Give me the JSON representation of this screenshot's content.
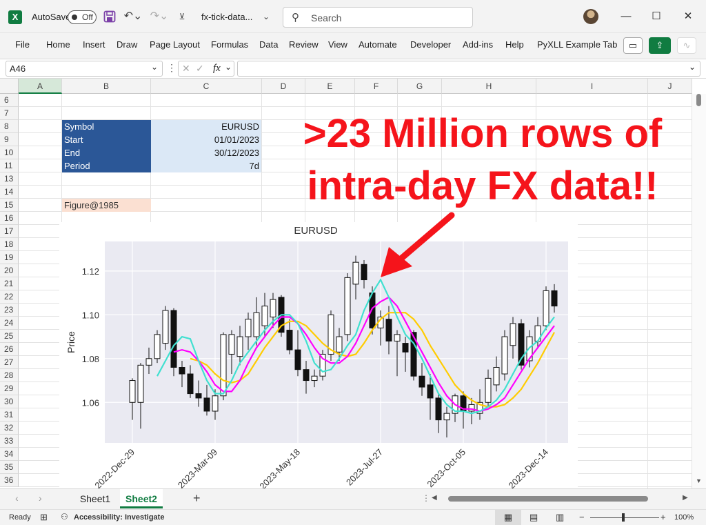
{
  "titlebar": {
    "autosave_label": "AutoSave",
    "autosave_state": "Off",
    "filename": "fx-tick-data...",
    "search_placeholder": "Search"
  },
  "ribbon": {
    "tabs": [
      "File",
      "Home",
      "Insert",
      "Draw",
      "Page Layout",
      "Formulas",
      "Data",
      "Review",
      "View",
      "Automate",
      "Developer",
      "Add-ins",
      "Help",
      "PyXLL Example Tab"
    ]
  },
  "formula_bar": {
    "name_box": "A46",
    "fx_label": "fx",
    "formula": ""
  },
  "grid": {
    "columns": [
      "A",
      "B",
      "C",
      "D",
      "E",
      "F",
      "G",
      "H",
      "I",
      "J"
    ],
    "rows": [
      "6",
      "7",
      "8",
      "9",
      "10",
      "11",
      "13",
      "14",
      "15",
      "16",
      "17",
      "18",
      "19",
      "20",
      "21",
      "22",
      "23",
      "24",
      "25",
      "26",
      "27",
      "28",
      "29",
      "30",
      "31",
      "32",
      "33",
      "34",
      "35",
      "36"
    ],
    "params": [
      {
        "label": "Symbol",
        "value": "EURUSD"
      },
      {
        "label": "Start",
        "value": "01/01/2023"
      },
      {
        "label": "End",
        "value": "30/12/2023"
      },
      {
        "label": "Period",
        "value": "7d"
      }
    ],
    "figure_cell": "Figure@1985"
  },
  "annotation": {
    "line1": ">23 Million rows of",
    "line2": "intra-day FX data!!",
    "color": "#f5141b"
  },
  "chart_data": {
    "type": "candlestick",
    "title": "EURUSD",
    "ylabel": "Price",
    "xlabel": "",
    "ylim": [
      1.0415,
      1.1335
    ],
    "yticks": [
      1.06,
      1.08,
      1.1,
      1.12
    ],
    "xticks": [
      "2022-Dec-29",
      "2023-Mar-09",
      "2023-May-18",
      "2023-Jul-27",
      "2023-Oct-05",
      "2023-Dec-14"
    ],
    "grid": true,
    "background": "#eaeaf2",
    "colors": {
      "up": "#ffffff",
      "down": "#111111",
      "ma_short": "#40e0d0",
      "ma_mid": "#ff00ff",
      "ma_long": "#ffcc00"
    },
    "candles": [
      {
        "o": 1.06,
        "h": 1.071,
        "l": 1.052,
        "c": 1.07
      },
      {
        "o": 1.06,
        "h": 1.078,
        "l": 1.048,
        "c": 1.077
      },
      {
        "o": 1.077,
        "h": 1.085,
        "l": 1.073,
        "c": 1.08
      },
      {
        "o": 1.08,
        "h": 1.093,
        "l": 1.078,
        "c": 1.091
      },
      {
        "o": 1.087,
        "h": 1.104,
        "l": 1.084,
        "c": 1.102
      },
      {
        "o": 1.102,
        "h": 1.103,
        "l": 1.072,
        "c": 1.076
      },
      {
        "o": 1.076,
        "h": 1.079,
        "l": 1.067,
        "c": 1.073
      },
      {
        "o": 1.073,
        "h": 1.077,
        "l": 1.062,
        "c": 1.064
      },
      {
        "o": 1.064,
        "h": 1.07,
        "l": 1.058,
        "c": 1.062
      },
      {
        "o": 1.062,
        "h": 1.068,
        "l": 1.054,
        "c": 1.056
      },
      {
        "o": 1.056,
        "h": 1.066,
        "l": 1.052,
        "c": 1.063
      },
      {
        "o": 1.063,
        "h": 1.092,
        "l": 1.061,
        "c": 1.091
      },
      {
        "o": 1.082,
        "h": 1.093,
        "l": 1.073,
        "c": 1.091
      },
      {
        "o": 1.081,
        "h": 1.095,
        "l": 1.077,
        "c": 1.09
      },
      {
        "o": 1.09,
        "h": 1.101,
        "l": 1.084,
        "c": 1.098
      },
      {
        "o": 1.09,
        "h": 1.108,
        "l": 1.086,
        "c": 1.101
      },
      {
        "o": 1.095,
        "h": 1.11,
        "l": 1.09,
        "c": 1.104
      },
      {
        "o": 1.099,
        "h": 1.11,
        "l": 1.094,
        "c": 1.107
      },
      {
        "o": 1.108,
        "h": 1.109,
        "l": 1.09,
        "c": 1.092
      },
      {
        "o": 1.093,
        "h": 1.098,
        "l": 1.082,
        "c": 1.084
      },
      {
        "o": 1.084,
        "h": 1.093,
        "l": 1.072,
        "c": 1.075
      },
      {
        "o": 1.075,
        "h": 1.079,
        "l": 1.064,
        "c": 1.07
      },
      {
        "o": 1.07,
        "h": 1.075,
        "l": 1.067,
        "c": 1.072
      },
      {
        "o": 1.072,
        "h": 1.084,
        "l": 1.07,
        "c": 1.082
      },
      {
        "o": 1.082,
        "h": 1.102,
        "l": 1.079,
        "c": 1.1
      },
      {
        "o": 1.083,
        "h": 1.094,
        "l": 1.079,
        "c": 1.09
      },
      {
        "o": 1.091,
        "h": 1.119,
        "l": 1.088,
        "c": 1.117
      },
      {
        "o": 1.114,
        "h": 1.127,
        "l": 1.107,
        "c": 1.124
      },
      {
        "o": 1.123,
        "h": 1.125,
        "l": 1.112,
        "c": 1.116
      },
      {
        "o": 1.11,
        "h": 1.113,
        "l": 1.091,
        "c": 1.094
      },
      {
        "o": 1.094,
        "h": 1.102,
        "l": 1.086,
        "c": 1.099
      },
      {
        "o": 1.098,
        "h": 1.104,
        "l": 1.082,
        "c": 1.088
      },
      {
        "o": 1.088,
        "h": 1.093,
        "l": 1.072,
        "c": 1.091
      },
      {
        "o": 1.087,
        "h": 1.09,
        "l": 1.074,
        "c": 1.083
      },
      {
        "o": 1.092,
        "h": 1.093,
        "l": 1.07,
        "c": 1.072
      },
      {
        "o": 1.072,
        "h": 1.078,
        "l": 1.063,
        "c": 1.067
      },
      {
        "o": 1.068,
        "h": 1.073,
        "l": 1.052,
        "c": 1.062
      },
      {
        "o": 1.062,
        "h": 1.064,
        "l": 1.046,
        "c": 1.052
      },
      {
        "o": 1.052,
        "h": 1.058,
        "l": 1.044,
        "c": 1.055
      },
      {
        "o": 1.055,
        "h": 1.064,
        "l": 1.051,
        "c": 1.063
      },
      {
        "o": 1.063,
        "h": 1.065,
        "l": 1.048,
        "c": 1.056
      },
      {
        "o": 1.056,
        "h": 1.062,
        "l": 1.05,
        "c": 1.059
      },
      {
        "o": 1.055,
        "h": 1.066,
        "l": 1.052,
        "c": 1.06
      },
      {
        "o": 1.06,
        "h": 1.075,
        "l": 1.058,
        "c": 1.071
      },
      {
        "o": 1.068,
        "h": 1.081,
        "l": 1.065,
        "c": 1.076
      },
      {
        "o": 1.073,
        "h": 1.093,
        "l": 1.07,
        "c": 1.09
      },
      {
        "o": 1.086,
        "h": 1.099,
        "l": 1.08,
        "c": 1.096
      },
      {
        "o": 1.096,
        "h": 1.098,
        "l": 1.075,
        "c": 1.077
      },
      {
        "o": 1.079,
        "h": 1.093,
        "l": 1.076,
        "c": 1.09
      },
      {
        "o": 1.088,
        "h": 1.099,
        "l": 1.085,
        "c": 1.095
      },
      {
        "o": 1.095,
        "h": 1.113,
        "l": 1.093,
        "c": 1.111
      },
      {
        "o": 1.111,
        "h": 1.114,
        "l": 1.101,
        "c": 1.104
      }
    ],
    "ma_short": [
      null,
      null,
      null,
      1.072,
      1.079,
      1.086,
      1.09,
      1.089,
      1.079,
      1.07,
      1.064,
      1.064,
      1.07,
      1.078,
      1.083,
      1.088,
      1.093,
      1.097,
      1.1,
      1.1,
      1.096,
      1.088,
      1.078,
      1.074,
      1.075,
      1.08,
      1.086,
      1.091,
      1.102,
      1.11,
      1.116,
      1.108,
      1.099,
      1.091,
      1.087,
      1.08,
      1.072,
      1.064,
      1.059,
      1.056,
      1.056,
      1.055,
      1.056,
      1.058,
      1.061,
      1.066,
      1.073,
      1.08,
      1.085,
      1.088,
      1.094,
      1.099
    ],
    "ma_mid": [
      null,
      null,
      null,
      null,
      null,
      1.083,
      1.084,
      1.083,
      1.079,
      1.074,
      1.068,
      1.065,
      1.065,
      1.07,
      1.078,
      1.085,
      1.09,
      1.095,
      1.099,
      1.099,
      1.096,
      1.091,
      1.085,
      1.08,
      1.078,
      1.078,
      1.081,
      1.087,
      1.095,
      1.103,
      1.106,
      1.108,
      1.104,
      1.097,
      1.09,
      1.083,
      1.076,
      1.069,
      1.063,
      1.059,
      1.057,
      1.057,
      1.056,
      1.057,
      1.059,
      1.062,
      1.068,
      1.074,
      1.08,
      1.085,
      1.09,
      1.095
    ],
    "ma_long": [
      null,
      null,
      null,
      null,
      null,
      null,
      null,
      1.08,
      1.079,
      1.077,
      1.073,
      1.07,
      1.069,
      1.07,
      1.073,
      1.079,
      1.085,
      1.09,
      1.095,
      1.097,
      1.097,
      1.095,
      1.091,
      1.087,
      1.084,
      1.082,
      1.081,
      1.082,
      1.087,
      1.093,
      1.098,
      1.101,
      1.101,
      1.101,
      1.098,
      1.093,
      1.086,
      1.08,
      1.074,
      1.068,
      1.064,
      1.061,
      1.059,
      1.058,
      1.058,
      1.059,
      1.062,
      1.066,
      1.072,
      1.078,
      1.085,
      1.092
    ]
  },
  "sheets": {
    "tabs": [
      "Sheet1",
      "Sheet2"
    ],
    "active": "Sheet2"
  },
  "status": {
    "ready": "Ready",
    "accessibility": "Accessibility: Investigate",
    "zoom": "100%"
  }
}
